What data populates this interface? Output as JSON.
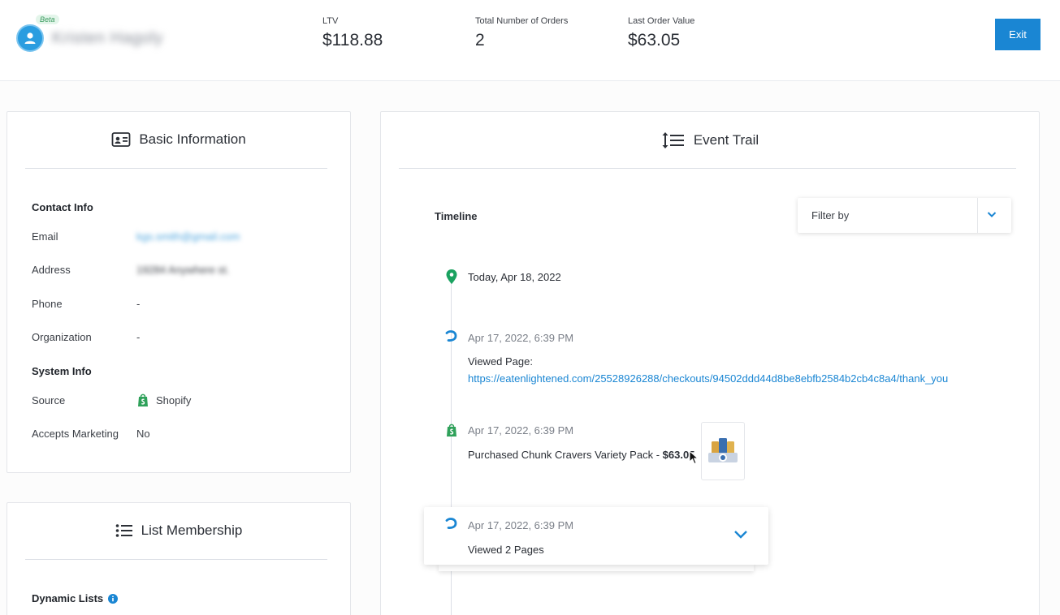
{
  "header": {
    "beta_badge": "Beta",
    "user_name": "Kristen Hagoly",
    "stats": [
      {
        "label": "LTV",
        "value": "$118.88"
      },
      {
        "label": "Total Number of Orders",
        "value": "2"
      },
      {
        "label": "Last Order Value",
        "value": "$63.05"
      }
    ],
    "exit_label": "Exit"
  },
  "basic_info": {
    "title": "Basic Information",
    "contact_heading": "Contact Info",
    "email_label": "Email",
    "email_value": "kgs.smith@gmail.com",
    "address_label": "Address",
    "address_value": "19284 Anywhere st.",
    "phone_label": "Phone",
    "phone_value": "-",
    "organization_label": "Organization",
    "organization_value": "-",
    "system_heading": "System Info",
    "source_label": "Source",
    "source_value": "Shopify",
    "accepts_marketing_label": "Accepts Marketing",
    "accepts_marketing_value": "No"
  },
  "list_membership": {
    "title": "List Membership",
    "dynamic_lists_label": "Dynamic Lists"
  },
  "event_trail": {
    "title": "Event Trail",
    "timeline_label": "Timeline",
    "filter_placeholder": "Filter by",
    "events": [
      {
        "icon": "location-pin-icon",
        "time": "Today, Apr 18, 2022"
      },
      {
        "icon": "page-view-icon",
        "time": "Apr 17, 2022, 6:39 PM",
        "text": "Viewed Page:",
        "link": "https://eatenlightened.com/25528926288/checkouts/94502ddd44d8be8ebfb2584b2cb4c8a4/thank_you"
      },
      {
        "icon": "shopify-icon",
        "time": "Apr 17, 2022, 6:39 PM",
        "text": "Purchased Chunk Cravers Variety Pack - ",
        "amount": "$63.05"
      },
      {
        "icon": "page-view-icon",
        "time": "Apr 17, 2022, 6:39 PM",
        "text": "Viewed 2 Pages"
      }
    ]
  },
  "colors": {
    "accent": "#1a86d3",
    "pin": "#1aa260",
    "shopify": "#2fa15a",
    "beta_bg": "#e3f5ea"
  }
}
